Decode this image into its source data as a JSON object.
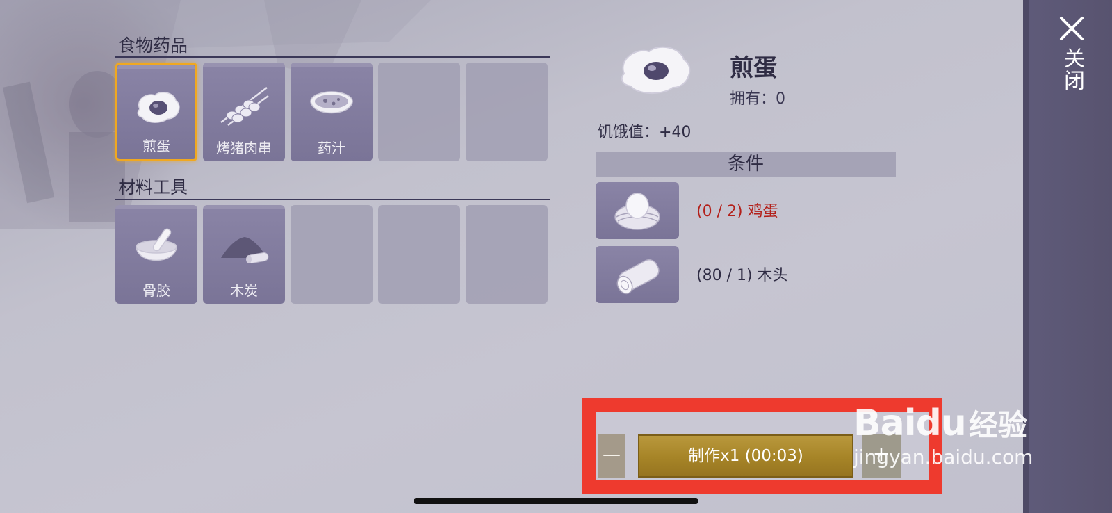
{
  "close": {
    "label": "关闭"
  },
  "sections": [
    {
      "title": "食物药品",
      "items": [
        {
          "label": "煎蛋",
          "icon": "fried-egg-icon",
          "selected": true
        },
        {
          "label": "烤猪肉串",
          "icon": "pork-skewer-icon"
        },
        {
          "label": "药汁",
          "icon": "herbal-bowl-icon"
        },
        {
          "label": "",
          "icon": ""
        },
        {
          "label": "",
          "icon": ""
        }
      ]
    },
    {
      "title": "材料工具",
      "items": [
        {
          "label": "骨胶",
          "icon": "mortar-pestle-icon"
        },
        {
          "label": "木炭",
          "icon": "charcoal-pile-icon"
        },
        {
          "label": "",
          "icon": ""
        },
        {
          "label": "",
          "icon": ""
        },
        {
          "label": "",
          "icon": ""
        }
      ]
    }
  ],
  "detail": {
    "name": "煎蛋",
    "owned": "拥有：0",
    "effect": "饥饿值：+40",
    "conditions_title": "条件",
    "requirements": [
      {
        "text": "(0 / 2) 鸡蛋",
        "icon": "egg-nest-icon",
        "color": "#b3201a"
      },
      {
        "text": "(80 / 1) 木头",
        "icon": "wood-log-icon",
        "color": "#2f2c44"
      }
    ]
  },
  "craft": {
    "minus_label": "—",
    "make_label": "制作x1 (00:03)",
    "plus_label": "+"
  },
  "watermark": {
    "brand": "Bai",
    "du": "du",
    "cn": "经验",
    "url": "jingyan.baidu.com"
  }
}
